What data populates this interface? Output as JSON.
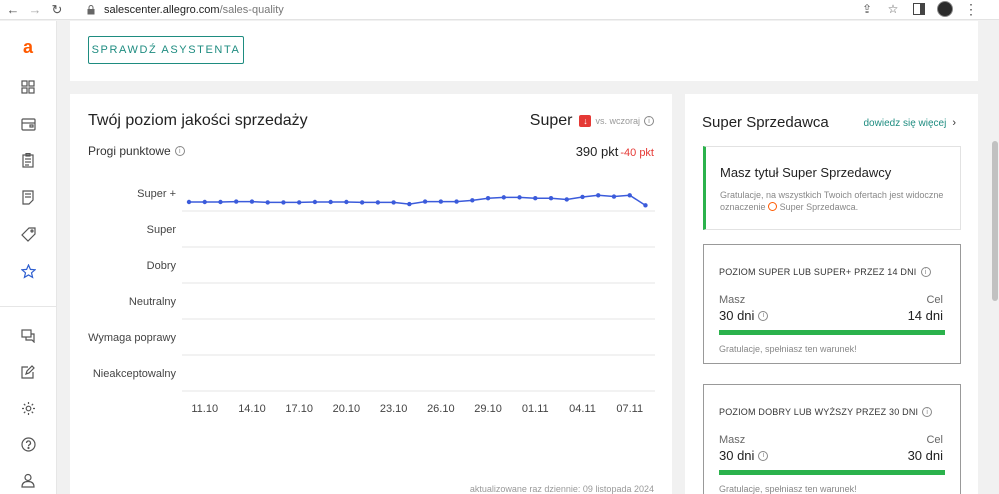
{
  "browser": {
    "url_host": "salescenter.allegro.com",
    "url_path": "/sales-quality"
  },
  "rail": {
    "logo": "a",
    "icons": [
      "grid-icon",
      "wallet-icon",
      "orders-icon",
      "offers-icon",
      "tag-icon",
      "star-icon",
      "chat-icon",
      "edit-icon",
      "gear-icon",
      "help-icon",
      "user-icon"
    ]
  },
  "top": {
    "assistant_button": "SPRAWDŹ ASYSTENTA"
  },
  "quality": {
    "title": "Twój poziom jakości sprzedaży",
    "level": "Super",
    "vs_label": "vs. wczoraj",
    "thresholds_label": "Progi punktowe",
    "points": "390 pkt",
    "delta": "-40 pkt",
    "updated": "aktualizowane raz dziennie: 09 listopada 2024"
  },
  "chart_data": {
    "type": "line",
    "y_categories": [
      "Super +",
      "Super",
      "Dobry",
      "Neutralny",
      "Wymaga poprawy",
      "Nieakceptowalny"
    ],
    "x_ticks": [
      "11.10",
      "14.10",
      "17.10",
      "20.10",
      "23.10",
      "26.10",
      "29.10",
      "01.11",
      "04.11",
      "07.11"
    ],
    "series_color": "#3b5bdb",
    "points": [
      {
        "x": "10.10",
        "y": 430
      },
      {
        "x": "11.10",
        "y": 430
      },
      {
        "x": "12.10",
        "y": 430
      },
      {
        "x": "13.10",
        "y": 431
      },
      {
        "x": "14.10",
        "y": 431
      },
      {
        "x": "15.10",
        "y": 429
      },
      {
        "x": "16.10",
        "y": 429
      },
      {
        "x": "17.10",
        "y": 429
      },
      {
        "x": "18.10",
        "y": 430
      },
      {
        "x": "19.10",
        "y": 430
      },
      {
        "x": "20.10",
        "y": 430
      },
      {
        "x": "21.10",
        "y": 429
      },
      {
        "x": "22.10",
        "y": 429
      },
      {
        "x": "23.10",
        "y": 429
      },
      {
        "x": "24.10",
        "y": 425
      },
      {
        "x": "25.10",
        "y": 431
      },
      {
        "x": "26.10",
        "y": 431
      },
      {
        "x": "27.10",
        "y": 431
      },
      {
        "x": "28.10",
        "y": 434
      },
      {
        "x": "29.10",
        "y": 439
      },
      {
        "x": "30.10",
        "y": 441
      },
      {
        "x": "31.10",
        "y": 441
      },
      {
        "x": "01.11",
        "y": 439
      },
      {
        "x": "02.11",
        "y": 439
      },
      {
        "x": "03.11",
        "y": 436
      },
      {
        "x": "04.11",
        "y": 442
      },
      {
        "x": "05.11",
        "y": 446
      },
      {
        "x": "06.11",
        "y": 443
      },
      {
        "x": "07.11",
        "y": 446
      },
      {
        "x": "08.11",
        "y": 422
      }
    ]
  },
  "seller": {
    "title": "Super Sprzedawca",
    "more_link": "dowiedz się więcej",
    "status_title": "Masz tytuł Super Sprzedawcy",
    "status_text_1": "Gratulacje, na wszystkich Twoich ofertach jest widoczne oznaczenie",
    "status_text_2": "Super Sprzedawca.",
    "conditions": [
      {
        "title": "POZIOM SUPER LUB SUPER+ PRZEZ 14 DNI",
        "have_label": "Masz",
        "have_value": "30 dni",
        "goal_label": "Cel",
        "goal_value": "14 dni",
        "progress": 1.0,
        "message": "Gratulacje, spełniasz ten warunek!"
      },
      {
        "title": "POZIOM DOBRY LUB WYŻSZY PRZEZ 30 DNI",
        "have_label": "Masz",
        "have_value": "30 dni",
        "goal_label": "Cel",
        "goal_value": "30 dni",
        "progress": 1.0,
        "message": "Gratulacje, spełniasz ten warunek!"
      }
    ]
  }
}
